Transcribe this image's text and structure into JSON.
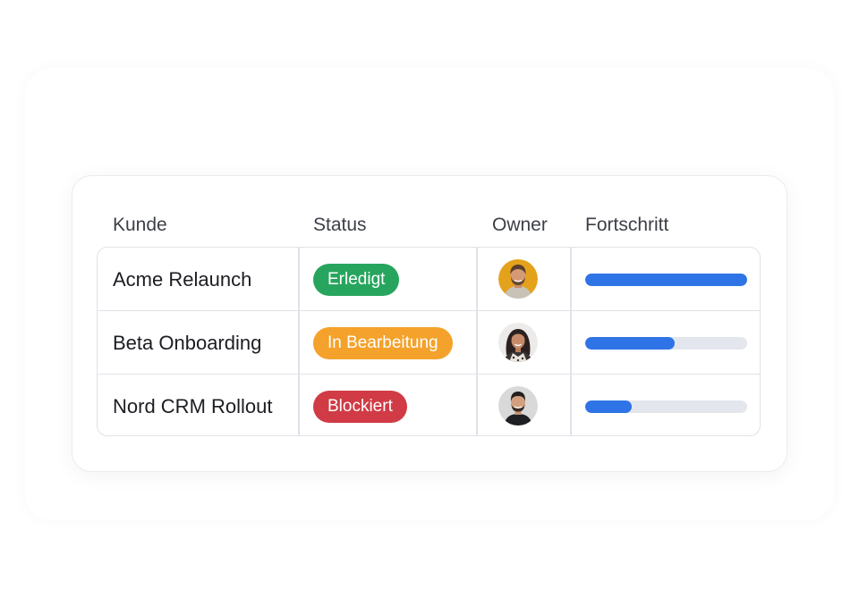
{
  "table": {
    "columns": {
      "customer": "Kunde",
      "status": "Status",
      "owner": "Owner",
      "progress": "Fortschritt"
    },
    "rows": [
      {
        "customer": "Acme Relaunch",
        "status": "Erledigt",
        "status_color": "#27a55e",
        "owner_avatar": "man-with-beard-avatar",
        "progress": 1.0
      },
      {
        "customer": "Beta Onboarding",
        "status": "In Bearbeitung",
        "status_color": "#f4a22b",
        "owner_avatar": "woman-with-curly-hair-avatar",
        "progress": 0.55
      },
      {
        "customer": "Nord CRM Rollout",
        "status": "Blockiert",
        "status_color": "#d03b45",
        "owner_avatar": "man-with-dark-hair-avatar",
        "progress": 0.29
      }
    ]
  },
  "colors": {
    "progress_fill": "#2f74e6",
    "progress_track": "#e3e6ec"
  }
}
